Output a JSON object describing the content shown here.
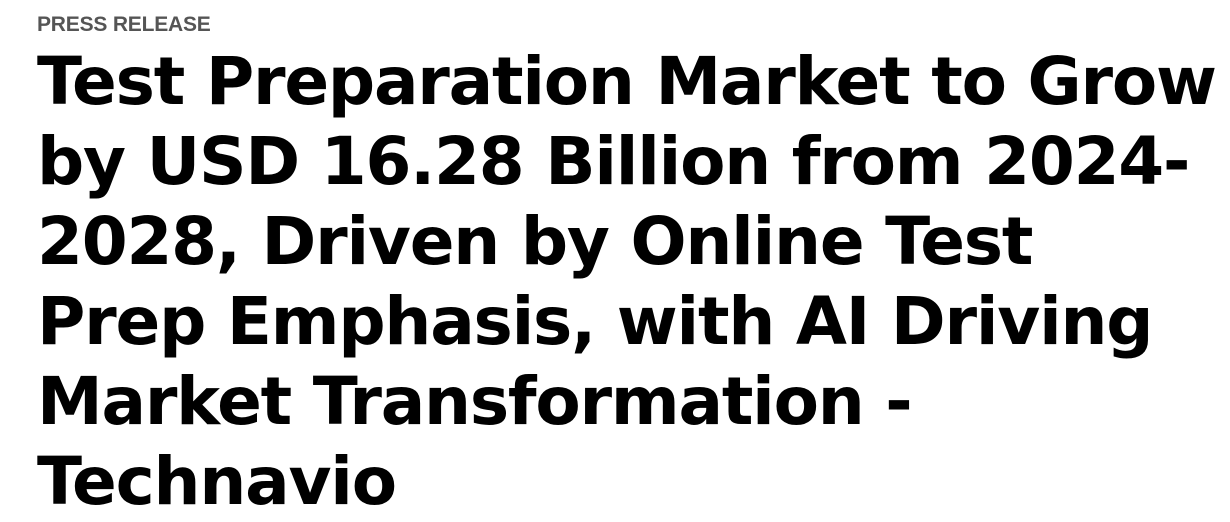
{
  "article": {
    "kicker": "PRESS RELEASE",
    "headline": "Test Preparation Market to Grow by USD 16.28 Billion from 2024-2028, Driven by Online Test Prep Emphasis, with AI Driving Market Transformation - Technavio"
  }
}
